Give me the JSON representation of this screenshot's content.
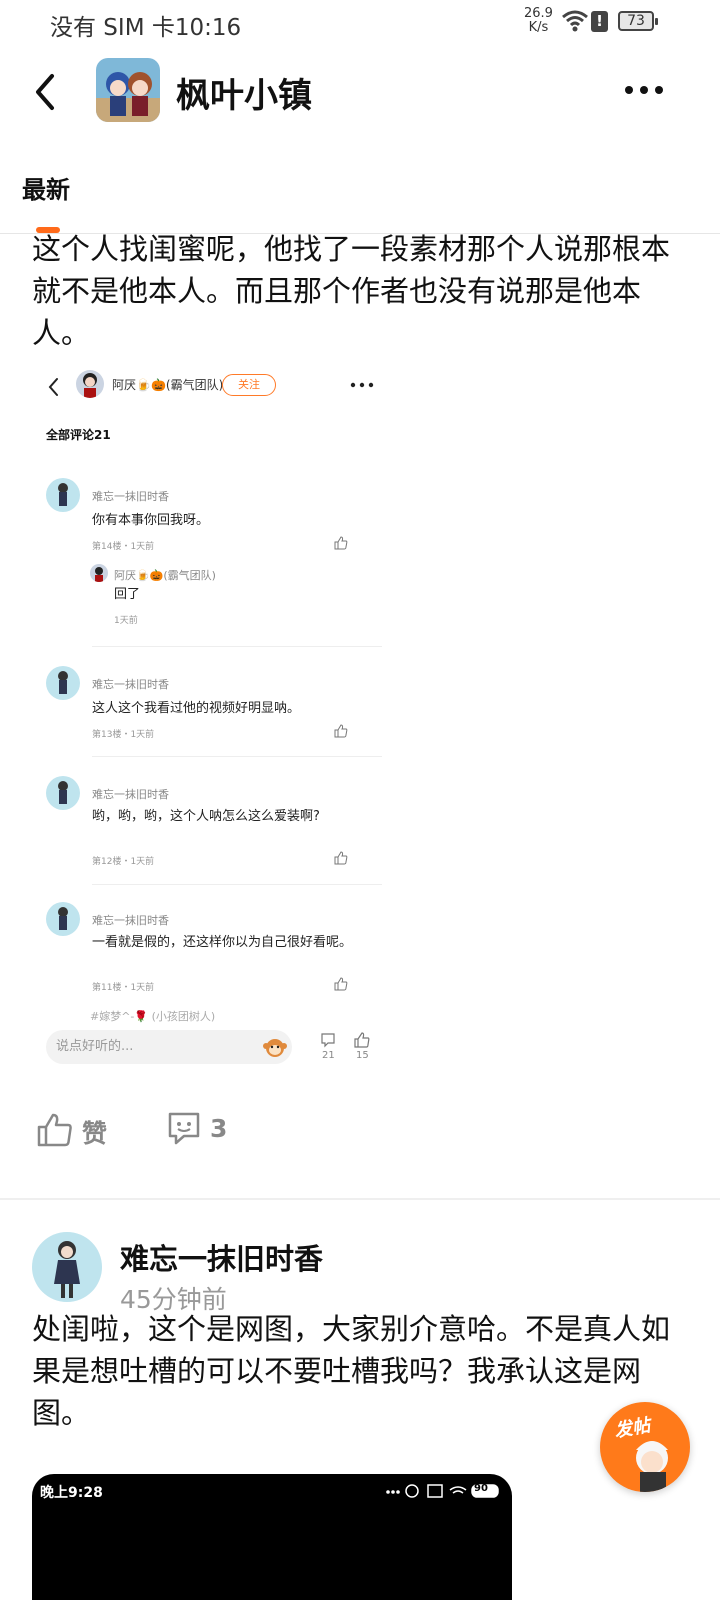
{
  "status_bar": {
    "carrier_time": "没有 SIM 卡10:16",
    "speed_value": "26.9",
    "speed_unit": "K/s",
    "alert": "!",
    "battery": "73"
  },
  "header": {
    "title": "枫叶小镇"
  },
  "tabs": {
    "active": "最新"
  },
  "post1": {
    "text": "这个人找闺蜜呢，他找了一段素材那个人说那根本就不是他本人。而且那个作者也没有说那是他本人。",
    "screenshot": {
      "author": "阿厌🍺🎃(霸气团队)",
      "follow": "关注",
      "all_comments": "全部评论21",
      "comments": [
        {
          "name": "难忘一抹旧时香",
          "text": "你有本事你回我呀。",
          "meta": "第14楼・1天前"
        },
        {
          "name": "难忘一抹旧时香",
          "text": "这人这个我看过他的视频好明显呐。",
          "meta": "第13楼・1天前"
        },
        {
          "name": "难忘一抹旧时香",
          "text": "哟，哟，哟，这个人呐怎么这么爱装啊?",
          "meta": "第12楼・1天前"
        },
        {
          "name": "难忘一抹旧时香",
          "text": "一看就是假的，还这样你以为自己很好看呢。",
          "meta": "第11楼・1天前"
        }
      ],
      "reply": {
        "name": "阿厌🍺🎃(霸气团队)",
        "text": "回了",
        "meta": "1天前"
      },
      "partial_next": "#嫁梦^-🌹 (小孩团树人)",
      "input_placeholder": "说点好听的...",
      "comment_count": "21",
      "like_count": "15"
    },
    "like_label": "赞",
    "comment_count": "3"
  },
  "post2": {
    "author": "难忘一抹旧时香",
    "time": "45分钟前",
    "text": "处闺啦，这个是网图，大家别介意哈。不是真人如果是想吐槽的可以不要吐槽我吗？我承认这是网图。",
    "phone_time": "晚上9:28",
    "phone_battery": "90"
  },
  "fab": {
    "label": "发帖"
  },
  "colors": {
    "accent": "#ff6a1a",
    "muted": "#888888"
  }
}
